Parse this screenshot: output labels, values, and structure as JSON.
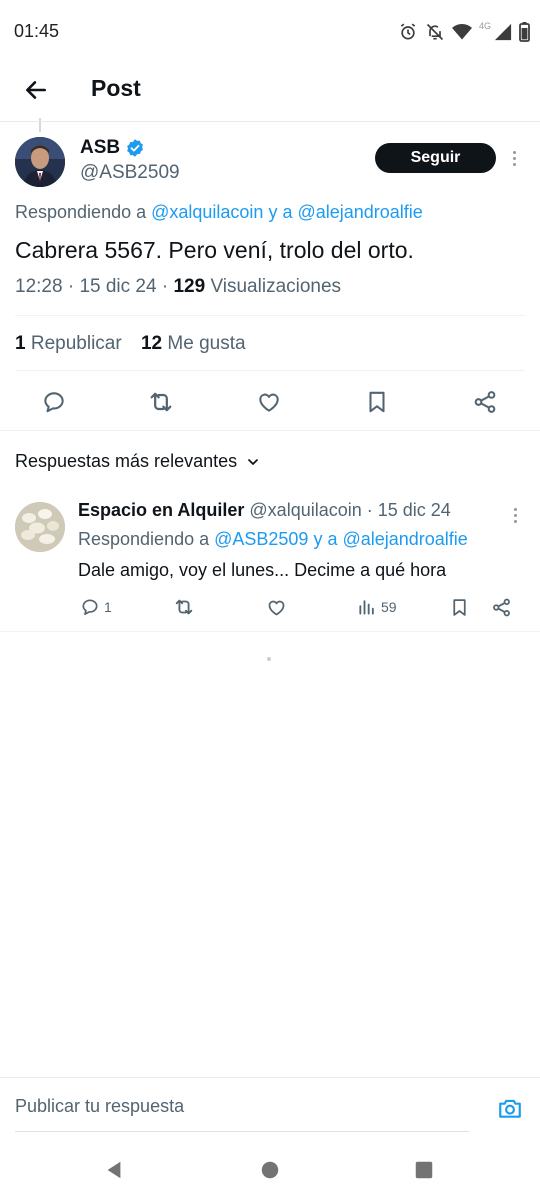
{
  "status_bar": {
    "time": "01:45",
    "network": "4G"
  },
  "header": {
    "title": "Post"
  },
  "post": {
    "author_name": "ASB",
    "author_handle": "@ASB2509",
    "follow_label": "Seguir",
    "replying_prefix": "Respondiendo a ",
    "replying_to": "@xalquilacoin y a @alejandroalfie",
    "text": "Cabrera 5567. Pero vení, trolo del orto.",
    "time": "12:28",
    "date": "15 dic 24",
    "views_count": "129",
    "views_label": "Visualizaciones",
    "reposts_count": "1",
    "reposts_label": "Republicar",
    "likes_count": "12",
    "likes_label": "Me gusta"
  },
  "sort": {
    "label": "Respuestas más relevantes"
  },
  "reply": {
    "author_name": "Espacio en Alquiler",
    "author_handle": "@xalquilacoin",
    "date": "15 dic 24",
    "replying_prefix": "Respondiendo a ",
    "replying_to": "@ASB2509 y a @alejandroalfie",
    "text": "Dale amigo, voy el lunes... Decime a qué hora",
    "comments_count": "1",
    "views_count": "59"
  },
  "compose": {
    "placeholder": "Publicar tu respuesta"
  },
  "colors": {
    "accent": "#1d9bf0",
    "text": "#0f1419",
    "secondary": "#536471"
  },
  "icons": [
    "back-arrow-icon",
    "verified-icon",
    "more-icon",
    "comment-icon",
    "repost-icon",
    "like-icon",
    "bookmark-icon",
    "share-icon",
    "chevron-down-icon",
    "views-icon",
    "camera-icon",
    "nav-back-icon",
    "nav-home-icon",
    "nav-recents-icon"
  ]
}
